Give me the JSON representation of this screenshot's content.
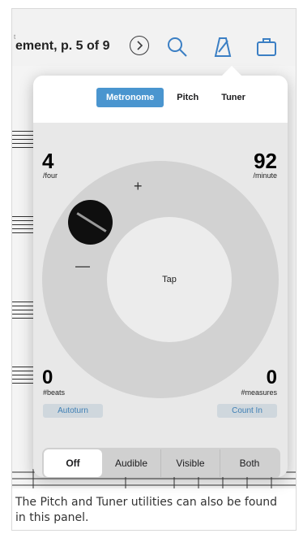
{
  "toolbar": {
    "tiny_mark": "t",
    "doc_title": "ement, p. 5 of 9",
    "icons": [
      "chevron-right-icon",
      "search-icon",
      "metronome-icon",
      "briefcase-icon"
    ]
  },
  "panel": {
    "tabs": [
      {
        "label": "Metronome",
        "active": true
      },
      {
        "label": "Pitch",
        "active": false
      },
      {
        "label": "Tuner",
        "active": false
      }
    ],
    "beat_unit": {
      "value": "4",
      "label": "/four"
    },
    "tempo": {
      "value": "92",
      "label": "/minute"
    },
    "dial": {
      "tap_label": "Tap",
      "plus": "+",
      "minus": "—"
    },
    "beats": {
      "value": "0",
      "label": "#beats",
      "button": "Autoturn"
    },
    "measures": {
      "value": "0",
      "label": "#measures",
      "button": "Count In"
    },
    "modes": [
      {
        "label": "Off",
        "active": true
      },
      {
        "label": "Audible",
        "active": false
      },
      {
        "label": "Visible",
        "active": false
      },
      {
        "label": "Both",
        "active": false
      }
    ]
  },
  "caption": "The Pitch and Tuner utilities can also be found in this panel.",
  "colors": {
    "accent": "#4a95cf",
    "panel_bg": "#e8e8e8",
    "dial": "#d2d2d2",
    "knob": "#0f0f0f"
  }
}
